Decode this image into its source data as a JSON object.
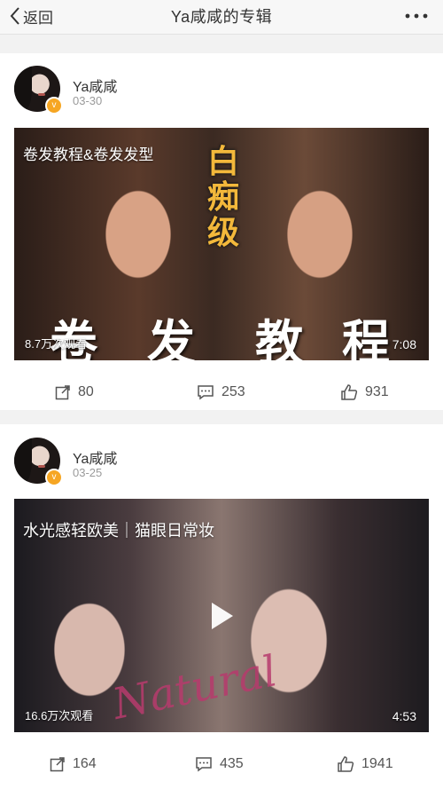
{
  "header": {
    "back_label": "返回",
    "title": "Ya咸咸的专辑"
  },
  "posts": [
    {
      "username": "Ya咸咸",
      "date": "03-30",
      "video": {
        "title": "卷发教程&卷发发型",
        "stamp_text": "白痴级",
        "big_text": [
          "卷",
          "发",
          "教",
          "程"
        ],
        "views": "8.7万次观看",
        "duration": "7:08"
      },
      "actions": {
        "repost": "80",
        "comment": "253",
        "like": "931"
      }
    },
    {
      "username": "Ya咸咸",
      "date": "03-25",
      "video": {
        "title": "水光感轻欧美｜猫眼日常妆",
        "script_text": "Natural",
        "views": "16.6万次观看",
        "duration": "4:53"
      },
      "actions": {
        "repost": "164",
        "comment": "435",
        "like": "1941"
      }
    }
  ],
  "icons": {
    "back": "chevron-left-icon",
    "more": "more-dots-icon",
    "verified": "verified-badge-icon",
    "repost": "repost-icon",
    "comment": "comment-icon",
    "like": "thumbs-up-icon",
    "play": "play-icon"
  },
  "colors": {
    "verified_badge": "#f6a623",
    "stamp_text": "#f3b83b",
    "script_text": "#b73b6d"
  }
}
